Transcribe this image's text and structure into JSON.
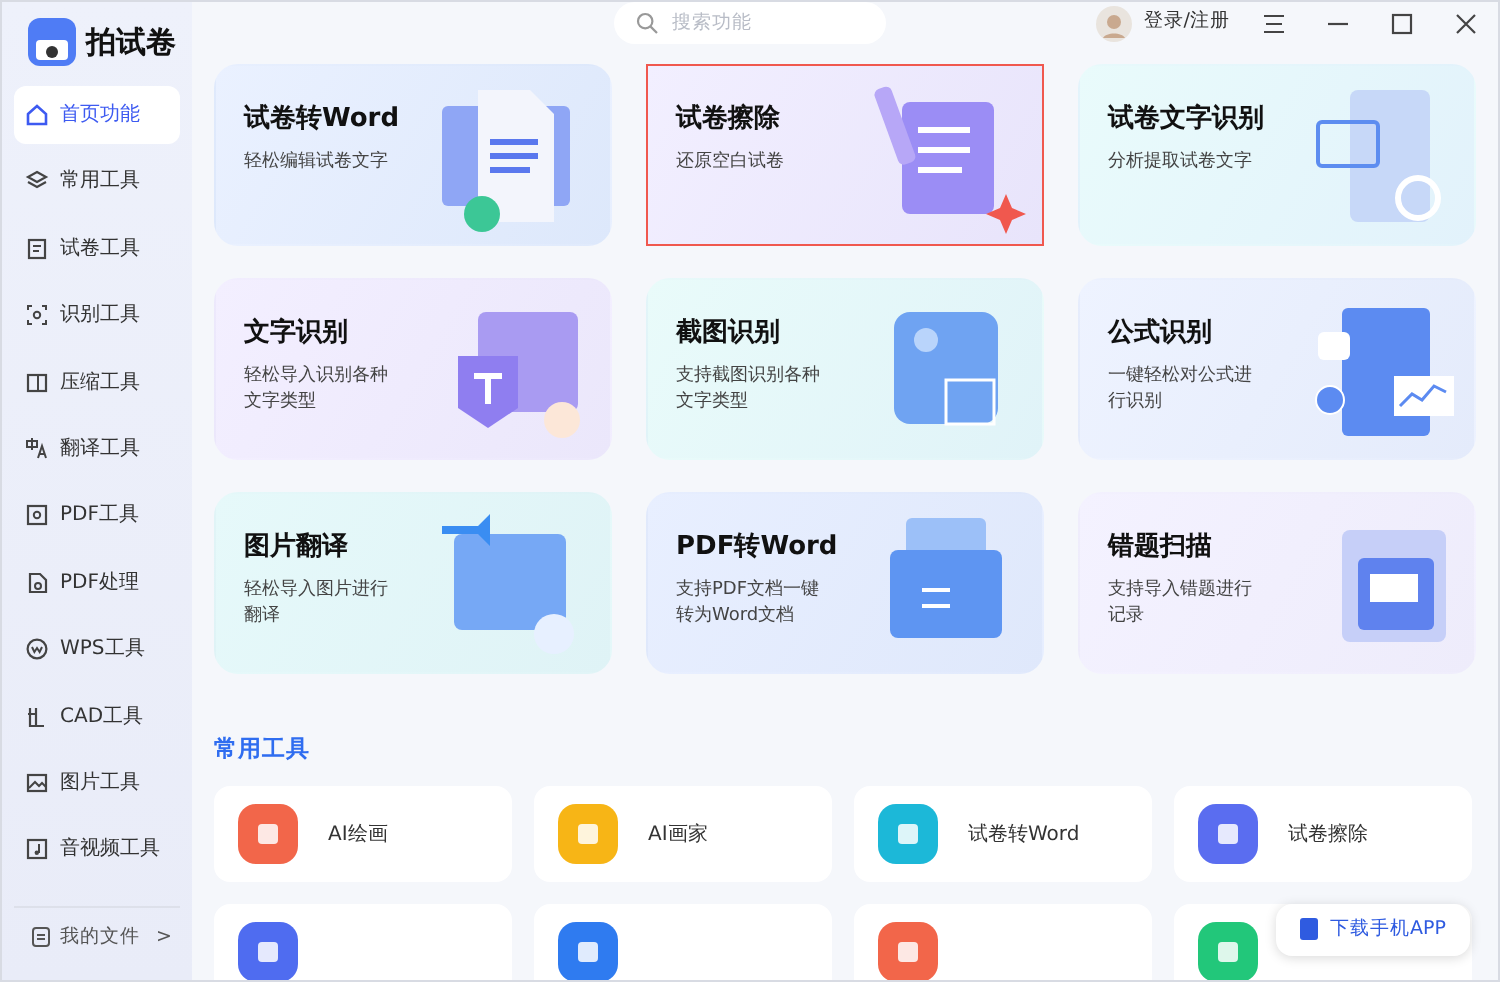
{
  "app": {
    "name": "拍试卷"
  },
  "search": {
    "placeholder": "搜索功能"
  },
  "account": {
    "label": "登录/注册"
  },
  "sidebar": {
    "items": [
      {
        "label": "首页功能",
        "selected": true
      },
      {
        "label": "常用工具",
        "selected": false
      },
      {
        "label": "试卷工具",
        "selected": false
      },
      {
        "label": "识别工具",
        "selected": false
      },
      {
        "label": "压缩工具",
        "selected": false
      },
      {
        "label": "翻译工具",
        "selected": false
      },
      {
        "label": "PDF工具",
        "selected": false
      },
      {
        "label": "PDF处理",
        "selected": false
      },
      {
        "label": "WPS工具",
        "selected": false
      },
      {
        "label": "CAD工具",
        "selected": false
      },
      {
        "label": "图片工具",
        "selected": false
      },
      {
        "label": "音视频工具",
        "selected": false
      }
    ],
    "footer": {
      "label": "我的文件",
      "chevron": ">"
    }
  },
  "features": [
    {
      "title": "试卷转Word",
      "subtitle": "轻松编辑试卷文字",
      "selected": false
    },
    {
      "title": "试卷擦除",
      "subtitle": "还原空白试卷",
      "selected": true
    },
    {
      "title": "试卷文字识别",
      "subtitle": "分析提取试卷文字",
      "selected": false
    },
    {
      "title": "文字识别",
      "subtitle": "轻松导入识别各种文字类型",
      "selected": false
    },
    {
      "title": "截图识别",
      "subtitle": "支持截图识别各种文字类型",
      "selected": false
    },
    {
      "title": "公式识别",
      "subtitle": "一键轻松对公式进行识别",
      "selected": false
    },
    {
      "title": "图片翻译",
      "subtitle": "轻松导入图片进行翻译",
      "selected": false
    },
    {
      "title": "PDF转Word",
      "subtitle": "支持PDF文档一键转为Word文档",
      "selected": false
    },
    {
      "title": "错题扫描",
      "subtitle": "支持导入错题进行记录",
      "selected": false
    }
  ],
  "common_tools": {
    "title": "常用工具",
    "items": [
      {
        "label": "AI绘画",
        "color": "#f2664a"
      },
      {
        "label": "AI画家",
        "color": "#f7b516"
      },
      {
        "label": "试卷转Word",
        "color": "#1cb8d8"
      },
      {
        "label": "试卷擦除",
        "color": "#5a6df0"
      },
      {
        "color": "#4f6cf0"
      },
      {
        "color": "#2f7bf0"
      },
      {
        "color": "#f2664a"
      },
      {
        "color": "#22c77a"
      }
    ]
  },
  "download_app": {
    "label": "下载手机APP"
  }
}
